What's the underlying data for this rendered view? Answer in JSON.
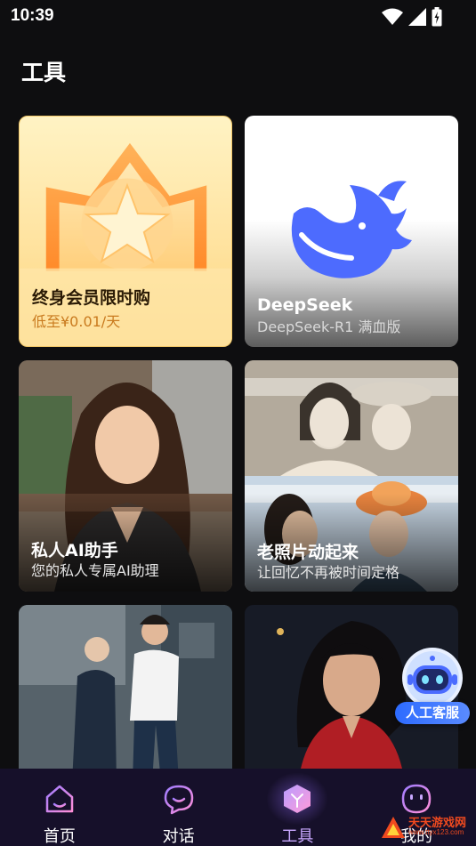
{
  "status_bar": {
    "time": "10:39"
  },
  "page": {
    "title": "工具"
  },
  "cards": [
    {
      "id": "member",
      "title": "终身会员限时购",
      "subtitle": "低至¥0.01/天"
    },
    {
      "id": "deepseek",
      "title": "DeepSeek",
      "subtitle": "DeepSeek-R1 满血版"
    },
    {
      "id": "assistant",
      "title": "私人AI助手",
      "subtitle": "您的私人专属AI助理"
    },
    {
      "id": "oldphoto",
      "title": "老照片动起来",
      "subtitle": "让回忆不再被时间定格"
    },
    {
      "id": "elder",
      "title": "",
      "subtitle": ""
    },
    {
      "id": "qipao",
      "title": "",
      "subtitle": ""
    }
  ],
  "customer_service": {
    "label": "人工客服"
  },
  "nav": {
    "items": [
      {
        "label": "首页",
        "icon": "home-icon"
      },
      {
        "label": "对话",
        "icon": "chat-icon"
      },
      {
        "label": "工具",
        "icon": "tool-cube-icon",
        "active": true
      },
      {
        "label": "我的",
        "icon": "profile-face-icon"
      }
    ]
  },
  "watermark": {
    "text": "天天游戏网",
    "sub": "www.ttyx123.com"
  },
  "colors": {
    "background": "#0e0e10",
    "nav_bg": "#16102a",
    "accent": "#8a5cff",
    "member_sub": "#c97a1e"
  }
}
